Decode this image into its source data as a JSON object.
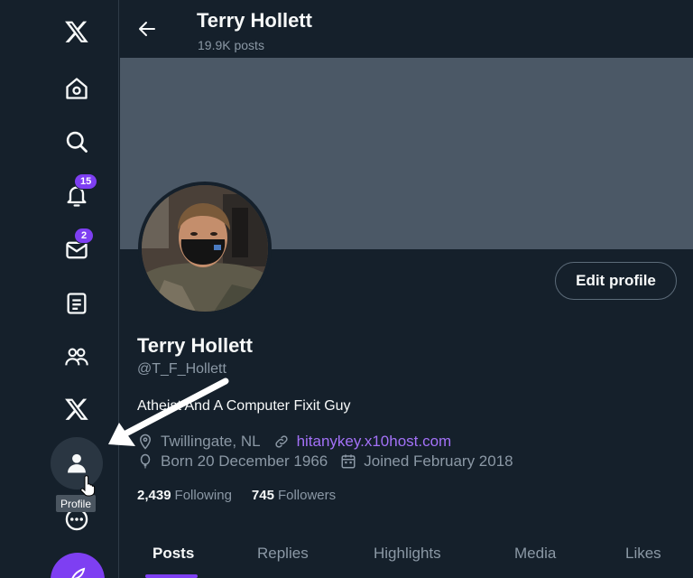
{
  "sidebar": {
    "items": [
      {
        "name": "x-logo",
        "icon": "x-logo-icon"
      },
      {
        "name": "home",
        "icon": "home-icon"
      },
      {
        "name": "explore",
        "icon": "search-icon"
      },
      {
        "name": "notifications",
        "icon": "bell-icon",
        "badge": "15"
      },
      {
        "name": "messages",
        "icon": "mail-icon",
        "badge": "2"
      },
      {
        "name": "lists",
        "icon": "list-icon"
      },
      {
        "name": "communities",
        "icon": "people-icon"
      },
      {
        "name": "premium",
        "icon": "x-logo-icon"
      },
      {
        "name": "profile",
        "icon": "person-icon"
      },
      {
        "name": "more",
        "icon": "more-icon"
      }
    ],
    "tooltip": "Profile",
    "accent": "#7e3ff2"
  },
  "header": {
    "name": "Terry Hollett",
    "posts": "19.9K posts"
  },
  "profile": {
    "edit_label": "Edit profile",
    "display_name": "Terry Hollett",
    "handle": "@T_F_Hollett",
    "bio": "Atheist And A Computer Fixit Guy",
    "location": "Twillingate, NL",
    "website": "hitanykey.x10host.com",
    "born": "Born 20 December 1966",
    "joined": "Joined February 2018",
    "following_count": "2,439",
    "following_label": "Following",
    "followers_count": "745",
    "followers_label": "Followers"
  },
  "tabs": [
    {
      "label": "Posts",
      "active": true
    },
    {
      "label": "Replies"
    },
    {
      "label": "Highlights"
    },
    {
      "label": "Media"
    },
    {
      "label": "Likes"
    }
  ]
}
